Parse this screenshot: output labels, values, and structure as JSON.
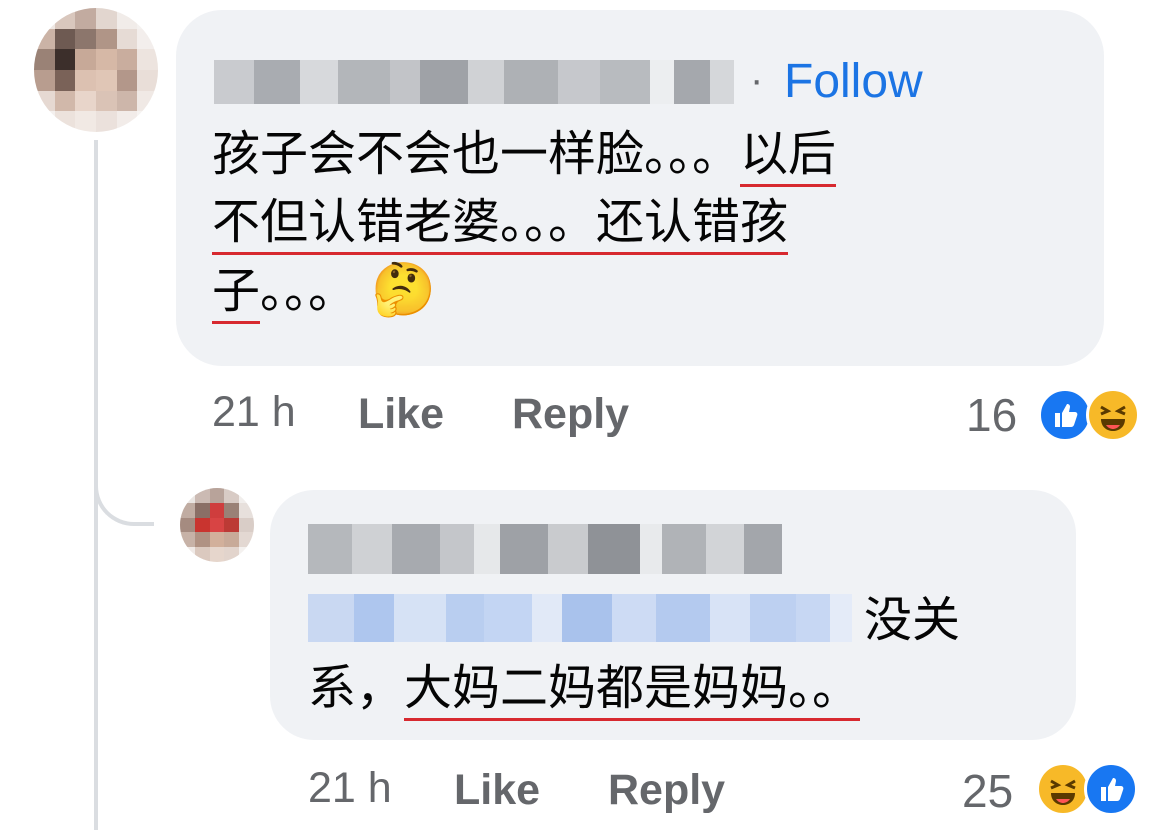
{
  "comment1": {
    "author_name": "",
    "follow_separator": "·",
    "follow_label": "Follow",
    "text_line1_a": "孩子会不会也一样脸。。。",
    "text_line1_b": "以后",
    "text_line2_a": "不但认错老婆。。。还认错孩",
    "text_line3_a": "子",
    "text_line3_b": "。。。",
    "emoji": "🤔",
    "time": "21 h",
    "like_label": "Like",
    "reply_label": "Reply",
    "reaction_count": "16",
    "reactions": [
      "like-icon",
      "haha-icon"
    ]
  },
  "comment2": {
    "author_name": "",
    "mention": "",
    "text_a": "没关",
    "text_b": "系，",
    "text_c": "大妈二妈都是妈妈。。",
    "time": "21 h",
    "like_label": "Like",
    "reply_label": "Reply",
    "reaction_count": "25",
    "reactions": [
      "haha-icon",
      "like-icon"
    ]
  },
  "colors": {
    "bubble": "#f0f2f5",
    "follow_blue": "#1b74e4",
    "meta_gray": "#65676b",
    "underline_red": "#d7292f",
    "like_blue": "#1877f2",
    "haha_yellow": "#f7b928"
  }
}
